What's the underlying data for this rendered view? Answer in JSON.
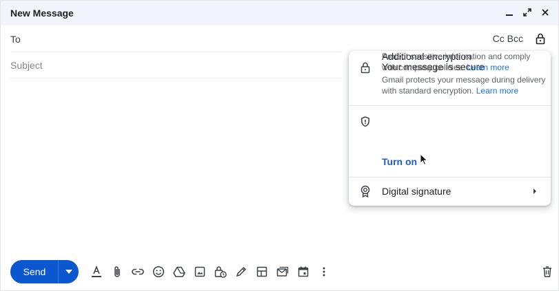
{
  "window": {
    "title": "New Message"
  },
  "recipients": {
    "to_label": "To",
    "cc_bcc_label": "Cc Bcc"
  },
  "subject": {
    "placeholder": "Subject",
    "value": ""
  },
  "encryption_popup": {
    "secure": {
      "title": "Your message is secure",
      "description": "Gmail protects your message during delivery with standard encryption.",
      "link": "Learn more"
    },
    "additional": {
      "title": "Additional encryption",
      "description": "Protect sensitive information and comply with company policies.",
      "link": "Learn more",
      "action": "Turn on"
    },
    "signature": {
      "title": "Digital signature"
    }
  },
  "toolbar": {
    "send_label": "Send",
    "tools": [
      "formatting-icon",
      "attach-icon",
      "link-icon",
      "emoji-icon",
      "drive-icon",
      "photo-icon",
      "confidential-icon",
      "signature-icon",
      "template-icon",
      "layout-icon",
      "schedule-icon",
      "more-options-icon"
    ]
  },
  "colors": {
    "accent": "#0b57d0",
    "link": "#1a73e8",
    "titlebar_bg": "#f2f6fc"
  }
}
